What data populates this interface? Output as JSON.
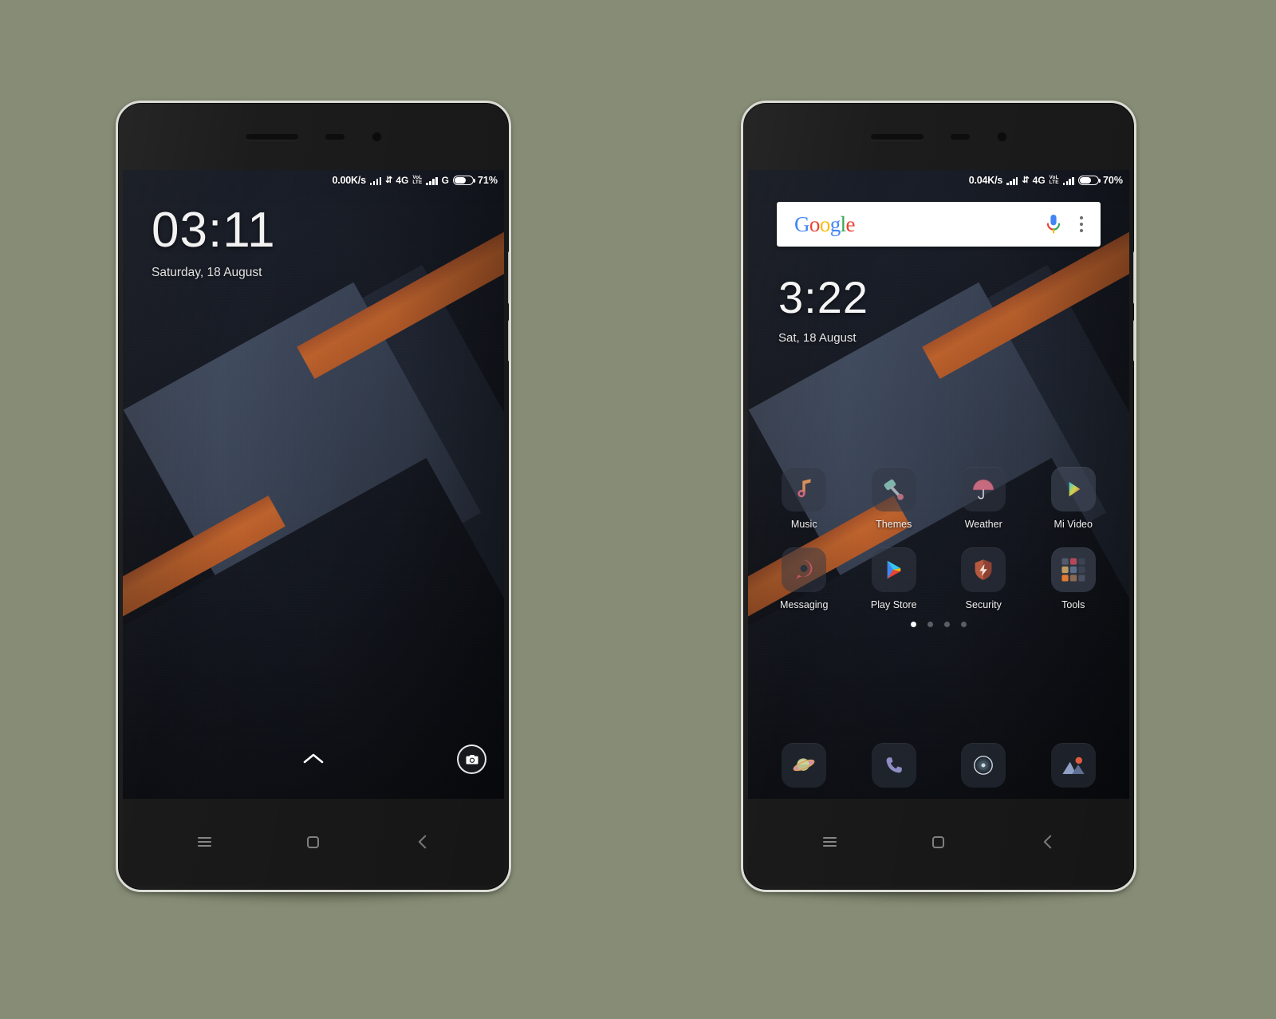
{
  "canvas": {
    "background_color": "#868c75"
  },
  "phones": [
    {
      "id": "left",
      "screen_type": "lockscreen",
      "status_bar": {
        "network_speed": "0.00K/s",
        "network_type": "4G",
        "volte_top": "VoL",
        "volte_bottom": "LTE",
        "second_network_type": "G",
        "battery_percent": "71%",
        "battery_level": 71
      },
      "clock": {
        "time": "03:11",
        "date": "Saturday, 18 August"
      },
      "bottom": {
        "unlock_hint": "chevron-up",
        "camera_shortcut": "camera-icon"
      },
      "nav_bar": {
        "menu": "menu",
        "home": "home",
        "back": "back"
      }
    },
    {
      "id": "right",
      "screen_type": "homescreen",
      "status_bar": {
        "network_speed": "0.04K/s",
        "network_type": "4G",
        "volte_top": "VoL",
        "volte_bottom": "LTE",
        "second_network_type": "",
        "battery_percent": "70%",
        "battery_level": 70
      },
      "search": {
        "logo_letters": [
          "G",
          "o",
          "o",
          "g",
          "l",
          "e"
        ],
        "placeholder": "",
        "value": "",
        "mic_icon": "microphone-icon",
        "menu_icon": "more-vertical-icon"
      },
      "clock": {
        "time": "3:22",
        "date": "Sat, 18 August"
      },
      "apps": [
        {
          "label": "Music",
          "icon": "music-note-icon"
        },
        {
          "label": "Themes",
          "icon": "paint-roller-icon"
        },
        {
          "label": "Weather",
          "icon": "umbrella-icon"
        },
        {
          "label": "Mi Video",
          "icon": "play-triangle-icon"
        },
        {
          "label": "Messaging",
          "icon": "speech-bubble-icon"
        },
        {
          "label": "Play Store",
          "icon": "google-play-icon"
        },
        {
          "label": "Security",
          "icon": "shield-bolt-icon"
        },
        {
          "label": "Tools",
          "icon": "folder-grid-icon"
        }
      ],
      "page_dots": {
        "count": 4,
        "active_index": 0
      },
      "dock": [
        {
          "label": "Browser",
          "icon": "planet-icon"
        },
        {
          "label": "Phone",
          "icon": "phone-handset-icon"
        },
        {
          "label": "Camera",
          "icon": "camera-lens-icon"
        },
        {
          "label": "Gallery",
          "icon": "photo-mountain-icon"
        }
      ],
      "nav_bar": {
        "menu": "menu",
        "home": "home",
        "back": "back"
      }
    }
  ],
  "colors": {
    "accent_orange": "#c2652e",
    "wallpaper_dark": "#171b25",
    "wallpaper_quad": "#3a4456",
    "frame": "#dcdcd6",
    "nav_bar": "#1a1a1a"
  }
}
